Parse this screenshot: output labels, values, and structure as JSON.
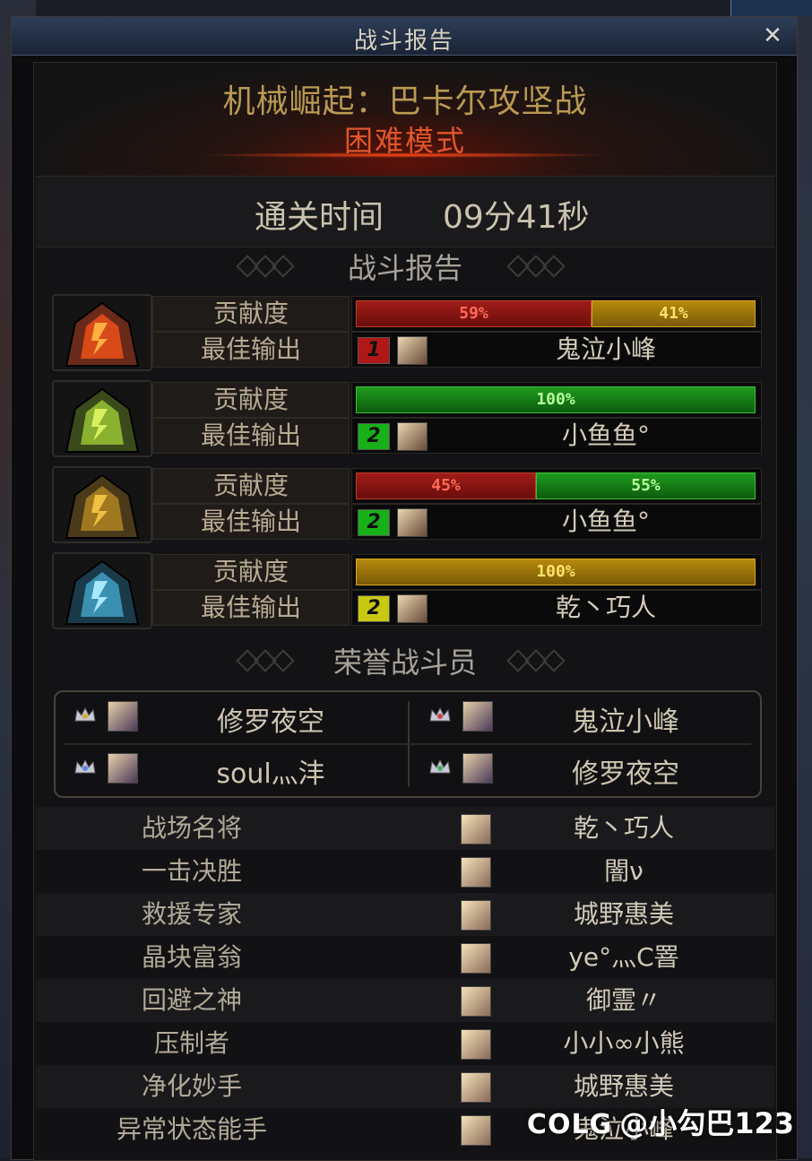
{
  "window": {
    "title": "战斗报告",
    "close_icon": "close-icon"
  },
  "header": {
    "dungeon_name": "机械崛起：巴卡尔攻坚战",
    "difficulty": "困难模式"
  },
  "clear": {
    "label": "通关时间",
    "value": "09分41秒"
  },
  "report": {
    "title": "战斗报告",
    "contribution_label": "贡献度",
    "best_output_label": "最佳输出",
    "bosses": [
      {
        "contribution": [
          {
            "value": "59%",
            "fraction": 0.59,
            "color": "red"
          },
          {
            "value": "41%",
            "fraction": 0.41,
            "color": "gold"
          }
        ],
        "best": {
          "job_icon": "1",
          "job_color": "#b01818",
          "name": "鬼泣小峰"
        }
      },
      {
        "contribution": [
          {
            "value": "100%",
            "fraction": 1.0,
            "color": "green"
          }
        ],
        "best": {
          "job_icon": "2",
          "job_color": "#18b018",
          "name": "小鱼鱼°"
        }
      },
      {
        "contribution": [
          {
            "value": "45%",
            "fraction": 0.45,
            "color": "red"
          },
          {
            "value": "55%",
            "fraction": 0.55,
            "color": "green"
          }
        ],
        "best": {
          "job_icon": "2",
          "job_color": "#18b018",
          "name": "小鱼鱼°"
        }
      },
      {
        "contribution": [
          {
            "value": "100%",
            "fraction": 1.0,
            "color": "gold"
          }
        ],
        "best": {
          "job_icon": "2",
          "job_color": "#c8c810",
          "name": "乾丶巧人"
        }
      }
    ]
  },
  "honor": {
    "title": "荣誉战斗员",
    "members": [
      {
        "name": "修罗夜空",
        "crown": "gold-crown-icon"
      },
      {
        "name": "鬼泣小峰",
        "crown": "red-crown-icon"
      },
      {
        "name": "soul灬沣",
        "crown": "blue-crown-icon"
      },
      {
        "name": "修罗夜空",
        "crown": "green-crown-icon"
      }
    ]
  },
  "awards": [
    {
      "title": "战场名将",
      "name": "乾丶巧人"
    },
    {
      "title": "一击决胜",
      "name": "闇ν"
    },
    {
      "title": "救援专家",
      "name": "城野惠美"
    },
    {
      "title": "晶块富翁",
      "name": "ye°灬C罯"
    },
    {
      "title": "回避之神",
      "name": "御霊〃"
    },
    {
      "title": "压制者",
      "name": "小小∞小熊"
    },
    {
      "title": "净化妙手",
      "name": "城野惠美"
    },
    {
      "title": "异常状态能手",
      "name": "鬼泣小峰"
    }
  ],
  "watermark": {
    "logo": "COLG",
    "text": "@小勾巴123"
  }
}
